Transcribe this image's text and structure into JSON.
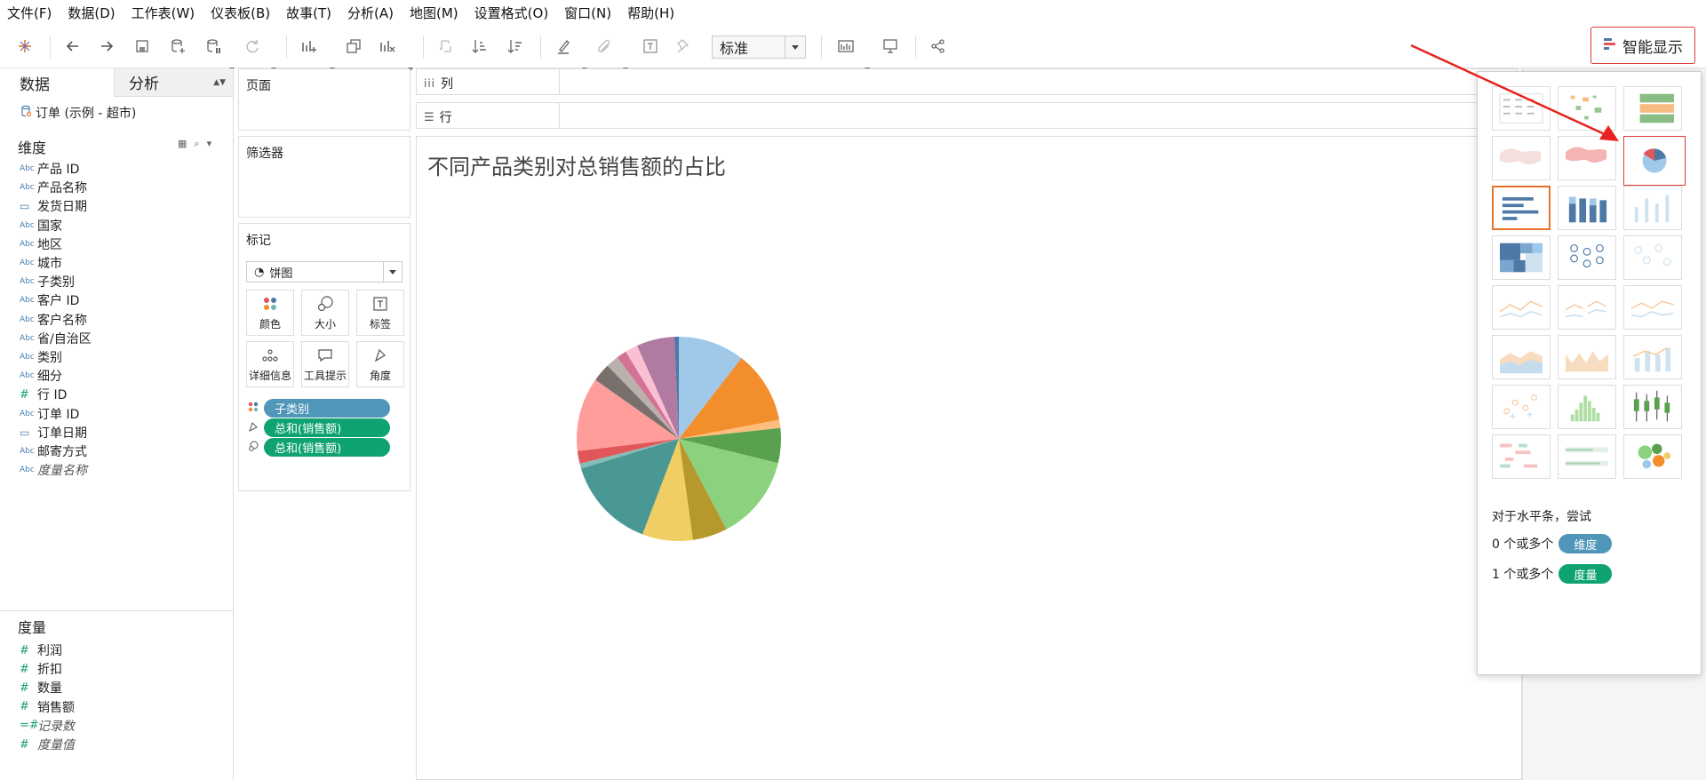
{
  "menu": [
    "文件(F)",
    "数据(D)",
    "工作表(W)",
    "仪表板(B)",
    "故事(T)",
    "分析(A)",
    "地图(M)",
    "设置格式(O)",
    "窗口(N)",
    "帮助(H)"
  ],
  "toolbar": {
    "fit_value": "标准",
    "show_me_label": "智能显示"
  },
  "data_pane": {
    "tab_data": "数据",
    "tab_analysis": "分析",
    "datasource": "订单 (示例 - 超市)",
    "dimensions_header": "维度",
    "dimensions": [
      {
        "type": "Abc",
        "name": "产品 ID"
      },
      {
        "type": "Abc",
        "name": "产品名称"
      },
      {
        "type": "date",
        "name": "发货日期"
      },
      {
        "type": "Abc",
        "name": "国家"
      },
      {
        "type": "Abc",
        "name": "地区"
      },
      {
        "type": "Abc",
        "name": "城市"
      },
      {
        "type": "Abc",
        "name": "子类别"
      },
      {
        "type": "Abc",
        "name": "客户 ID"
      },
      {
        "type": "Abc",
        "name": "客户名称"
      },
      {
        "type": "Abc",
        "name": "省/自治区"
      },
      {
        "type": "Abc",
        "name": "类别"
      },
      {
        "type": "Abc",
        "name": "细分"
      },
      {
        "type": "#",
        "name": "行 ID"
      },
      {
        "type": "Abc",
        "name": "订单 ID"
      },
      {
        "type": "date",
        "name": "订单日期"
      },
      {
        "type": "Abc",
        "name": "邮寄方式"
      },
      {
        "type": "Abc",
        "name": "度量名称",
        "italic": true
      }
    ],
    "measures_header": "度量",
    "measures": [
      {
        "type": "#",
        "name": "利润"
      },
      {
        "type": "#",
        "name": "折扣"
      },
      {
        "type": "#",
        "name": "数量"
      },
      {
        "type": "#",
        "name": "销售额"
      },
      {
        "type": "=#",
        "name": "记录数",
        "italic": true
      },
      {
        "type": "#",
        "name": "度量值",
        "italic": true
      }
    ]
  },
  "cards": {
    "pages": "页面",
    "filters": "筛选器",
    "marks": "标记",
    "marks_type": "饼图",
    "mark_buttons": [
      "颜色",
      "大小",
      "标签",
      "详细信息",
      "工具提示",
      "角度"
    ],
    "mark_pills": [
      {
        "kind": "dim",
        "icon": "color",
        "label": "子类别"
      },
      {
        "kind": "mea",
        "icon": "angle",
        "label": "总和(销售额)"
      },
      {
        "kind": "mea",
        "icon": "size",
        "label": "总和(销售额)"
      }
    ]
  },
  "shelves": {
    "columns": "列",
    "rows": "行"
  },
  "view": {
    "title": "不同产品类别对总销售额的占比"
  },
  "show_me": {
    "hint": "对于水平条，尝试",
    "req1_text": "0 个或多个",
    "req1_pill": "维度",
    "req2_text": "1 个或多个",
    "req2_pill": "度量"
  },
  "chart_data": {
    "type": "pie",
    "title": "不同产品类别对总销售额的占比",
    "slices": [
      {
        "value": 10.5,
        "color": "#a0c8e8"
      },
      {
        "value": 11.5,
        "color": "#f28e2b"
      },
      {
        "value": 1.3,
        "color": "#ffbe7d"
      },
      {
        "value": 5.5,
        "color": "#59a14f"
      },
      {
        "value": 13.5,
        "color": "#8cd17d"
      },
      {
        "value": 5.5,
        "color": "#b6992d"
      },
      {
        "value": 8.0,
        "color": "#f1ce63"
      },
      {
        "value": 14.5,
        "color": "#499894"
      },
      {
        "value": 0.8,
        "color": "#86bcb6"
      },
      {
        "value": 2.0,
        "color": "#e15759"
      },
      {
        "value": 11.7,
        "color": "#ff9d9a"
      },
      {
        "value": 2.9,
        "color": "#79706e"
      },
      {
        "value": 2.0,
        "color": "#bab0ac"
      },
      {
        "value": 1.6,
        "color": "#d37295"
      },
      {
        "value": 2.0,
        "color": "#fabfd2"
      },
      {
        "value": 6.0,
        "color": "#b07aa1"
      },
      {
        "value": 0.7,
        "color": "#4e79a7"
      }
    ]
  }
}
